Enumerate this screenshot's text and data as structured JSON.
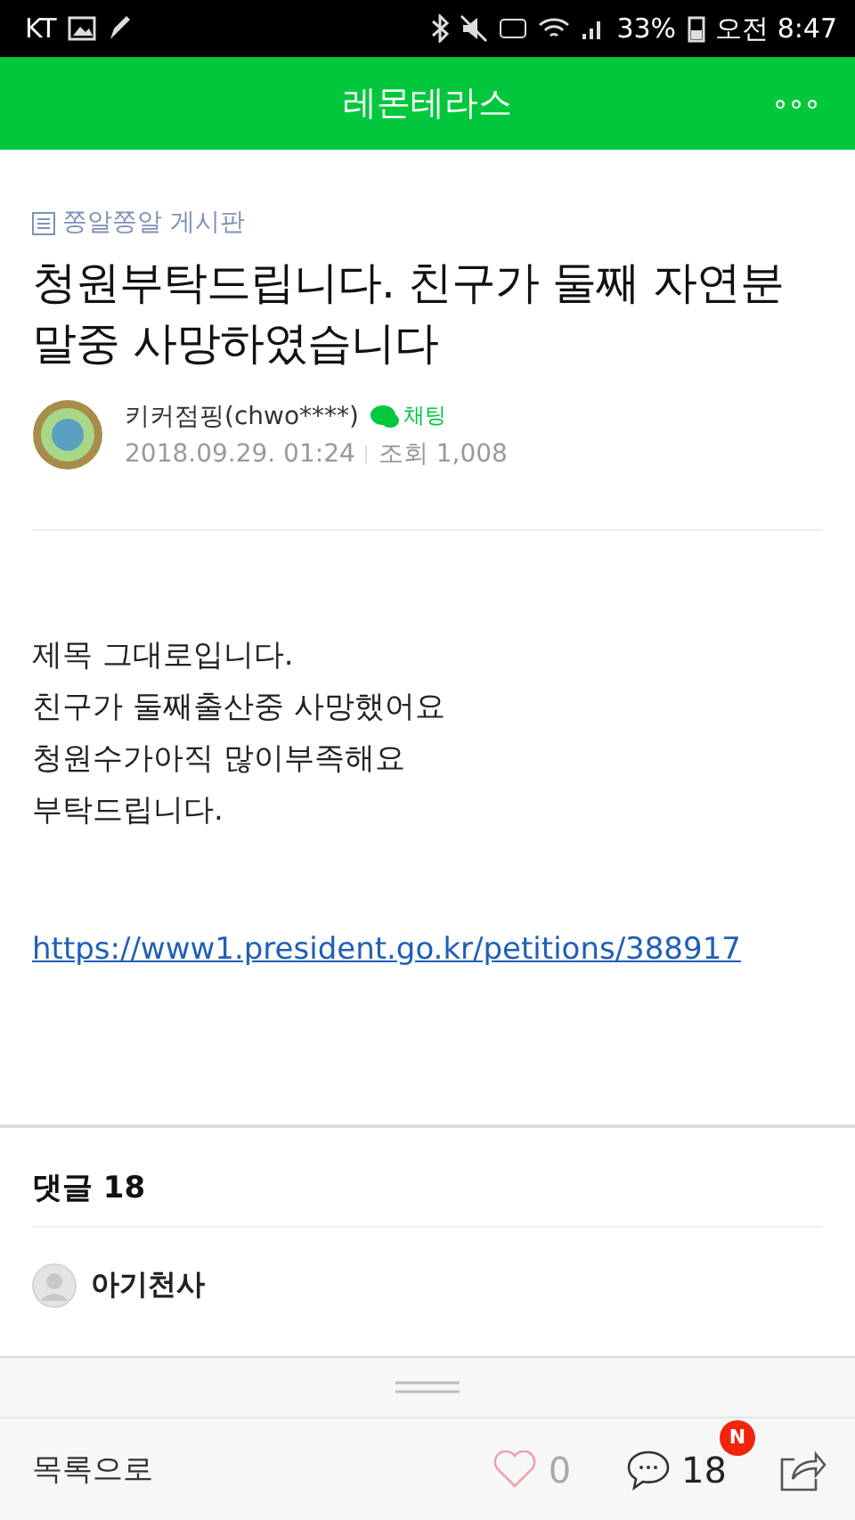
{
  "status_bar": {
    "carrier": "KT",
    "battery": "33%",
    "time": "오전 8:47"
  },
  "header": {
    "title": "레몬테라스",
    "menu": "∘∘∘"
  },
  "post": {
    "board": "쫑알쫑알 게시판",
    "title": "청원부탁드립니다. 친구가 둘째 자연분말중 사망하였습니다",
    "author": "키커점핑(chwo****)",
    "chat": "채팅",
    "date": "2018.09.29. 01:24",
    "views": "조회 1,008",
    "body": [
      "제목 그대로입니다.",
      "친구가 둘째출산중 사망했어요",
      "청원수가아직 많이부족해요",
      "부탁드립니다."
    ],
    "link": "https://www1.president.go.kr/petitions/388917"
  },
  "comments": {
    "heading": "댓글 18",
    "items": [
      {
        "author": "아기천사"
      }
    ]
  },
  "bottom_bar": {
    "back": "목록으로",
    "likes": "0",
    "liked": false,
    "comments": "18",
    "new_badge": "N"
  }
}
